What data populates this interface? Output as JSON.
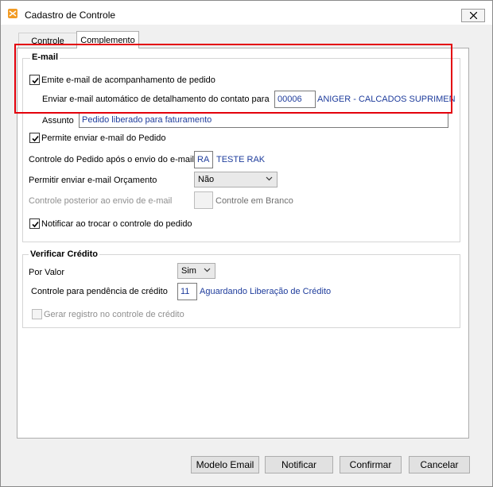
{
  "window": {
    "title": "Cadastro de Controle"
  },
  "tabs": [
    {
      "label": "Controle"
    },
    {
      "label": "Complemento"
    }
  ],
  "email_group": {
    "title": "E-mail",
    "emite_label": "Emite e-mail de acompanhamento de pedido",
    "emite_checked": true,
    "enviar_auto_label": "Enviar e-mail automático de detalhamento do contato para",
    "contato_code": "00006",
    "contato_name": "ANIGER - CALCADOS SUPRIMEN",
    "assunto_label": "Assunto",
    "assunto_value": "Pedido liberado para faturamento",
    "permite_label": "Permite enviar e-mail do Pedido",
    "permite_checked": true,
    "controle_apos_label": "Controle do Pedido após o envio do e-mail",
    "controle_apos_code": "RA",
    "controle_apos_name": "TESTE RAK",
    "orcamento_label": "Permitir enviar e-mail Orçamento",
    "orcamento_value": "Não",
    "posterior_label": "Controle posterior ao envio de e-mail",
    "posterior_code": "",
    "posterior_name": "Controle em Branco",
    "notificar_label": "Notificar ao trocar o controle do pedido",
    "notificar_checked": true
  },
  "credito_group": {
    "title": "Verificar Crédito",
    "por_valor_label": "Por Valor",
    "por_valor_value": "Sim",
    "pendencia_label": "Controle para pendência de crédito",
    "pendencia_code": "11",
    "pendencia_name": "Aguardando Liberação de Crédito",
    "gerar_label": "Gerar registro no controle de crédito",
    "gerar_checked": false
  },
  "buttons": {
    "modelo_email": "Modelo Email",
    "notificar": "Notificar",
    "confirmar": "Confirmar",
    "cancelar": "Cancelar"
  },
  "colors": {
    "highlight": "#e3000b",
    "link_blue": "#1e3c9c"
  }
}
